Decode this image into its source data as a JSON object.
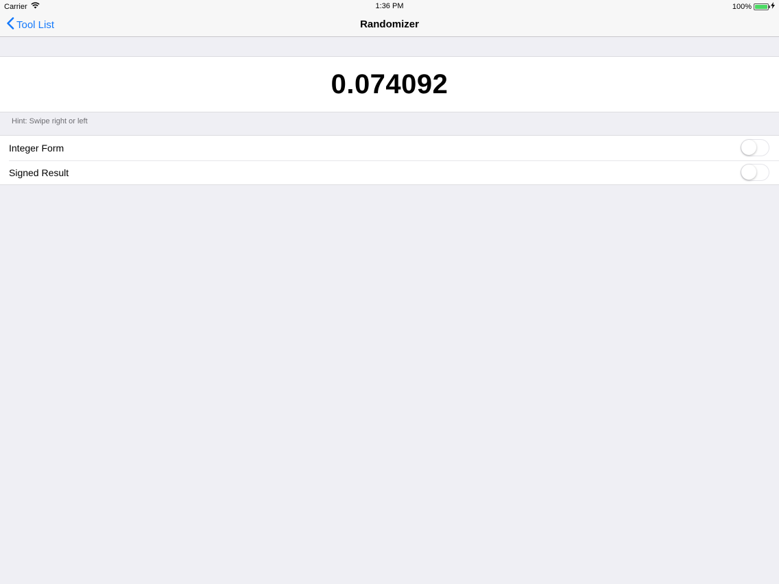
{
  "status_bar": {
    "carrier": "Carrier",
    "time": "1:36 PM",
    "battery_percent": "100%",
    "battery_level": 1.0,
    "battery_color": "#4cd964"
  },
  "nav": {
    "back_label": "Tool List",
    "title": "Randomizer",
    "accent_color": "#1479fb"
  },
  "result": {
    "value": "0.074092"
  },
  "hint": "Hint: Swipe right or left",
  "settings": [
    {
      "label": "Integer Form",
      "on": false
    },
    {
      "label": "Signed Result",
      "on": false
    }
  ]
}
